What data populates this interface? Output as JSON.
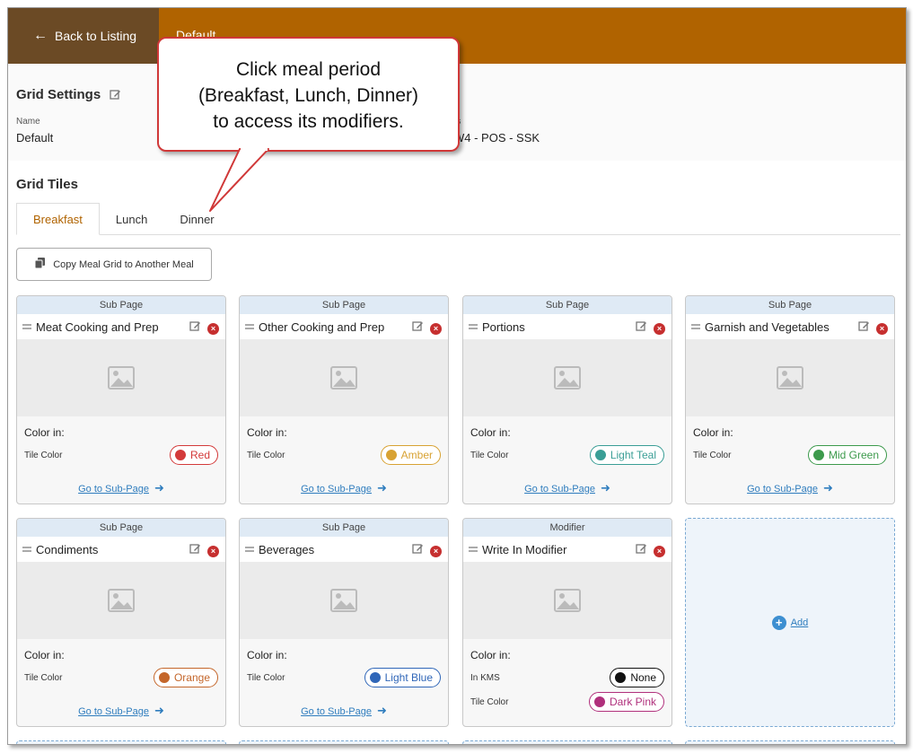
{
  "topbar": {
    "back_label": "Back to Listing",
    "title": "Default"
  },
  "settings": {
    "title": "Grid Settings",
    "name_label": "Name",
    "name_value": "Default",
    "other_label": "rs",
    "other_value": "W4 - POS - SSK"
  },
  "tiles": {
    "title": "Grid Tiles",
    "tabs": [
      "Breakfast",
      "Lunch",
      "Dinner"
    ],
    "active_tab": "Breakfast",
    "copy_label": "Copy Meal Grid to Another Meal",
    "color_in_label": "Color in:",
    "tile_color_label": "Tile Color",
    "in_kms_label": "In KMS",
    "go_label": "Go to Sub-Page",
    "add_label": "Add",
    "cards": [
      {
        "type": "Sub Page",
        "name": "Meat Cooking and Prep",
        "color": "Red",
        "hex": "#d33a3a"
      },
      {
        "type": "Sub Page",
        "name": "Other Cooking and Prep",
        "color": "Amber",
        "hex": "#d8a233"
      },
      {
        "type": "Sub Page",
        "name": "Portions",
        "color": "Light Teal",
        "hex": "#3a9e96"
      },
      {
        "type": "Sub Page",
        "name": "Garnish and Vegetables",
        "color": "Mid Green",
        "hex": "#3d9a4c"
      },
      {
        "type": "Sub Page",
        "name": "Condiments",
        "color": "Orange",
        "hex": "#c4662a"
      },
      {
        "type": "Sub Page",
        "name": "Beverages",
        "color": "Light Blue",
        "hex": "#2f66b8"
      },
      {
        "type": "Modifier",
        "name": "Write In Modifier",
        "kms_color": "None",
        "kms_hex": "#111111",
        "color": "Dark Pink",
        "hex": "#b0307c"
      }
    ]
  },
  "callout": {
    "line1": "Click meal period",
    "line2": "(Breakfast, Lunch, Dinner)",
    "line3": "to access its modifiers."
  },
  "colors": {
    "topbar": "#b06300",
    "back": "#6b4a25",
    "link": "#2f7dbe",
    "accent": "#b06300"
  }
}
